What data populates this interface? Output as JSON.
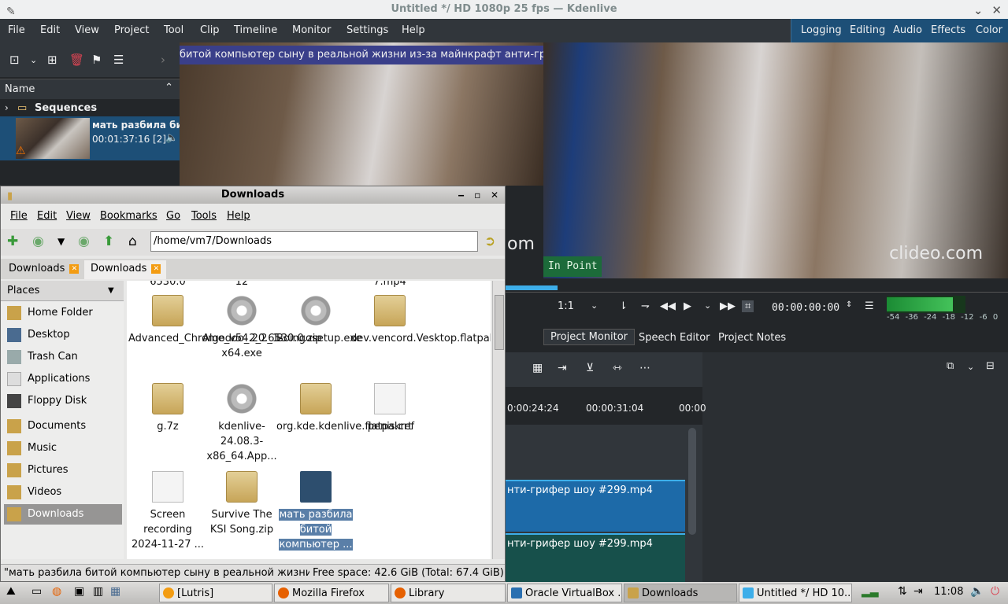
{
  "window": {
    "title": "Untitled */ HD 1080p 25 fps — Kdenlive"
  },
  "menubar": {
    "items": [
      "File",
      "Edit",
      "View",
      "Project",
      "Tool",
      "Clip",
      "Timeline",
      "Monitor",
      "Settings",
      "Help"
    ]
  },
  "layouts": [
    "Logging",
    "Editing",
    "Audio",
    "Effects",
    "Color"
  ],
  "bin": {
    "header": "Name",
    "sequences": "Sequences",
    "clip_name": "мать разбила бит",
    "clip_info": "00:01:37:16 [2]"
  },
  "project_monitor": {
    "caption": "битой компьютер сыну в реальной жизни из-за майнкрафт анти-грифер ш"
  },
  "clip_monitor": {
    "watermark": "clideo.com",
    "watermark_partial": "om",
    "in_point": "In Point"
  },
  "monitor_controls": {
    "zoom": "1:1",
    "timecode": "00:00:00:00",
    "scale": [
      "-54",
      "-36",
      "-24",
      "-18",
      "-12",
      "-6",
      "0"
    ]
  },
  "monitor_tabs": [
    "Project Monitor",
    "Speech Editor",
    "Project Notes"
  ],
  "timeline": {
    "ticks": [
      "0:00:24:24",
      "00:00:31:04",
      "00:00"
    ],
    "video_clip": "нти-грифер шоу #299.mp4",
    "audio_clip": "нти-грифер шоу #299.mp4"
  },
  "filemanager": {
    "title": "Downloads",
    "menu": [
      "File",
      "Edit",
      "View",
      "Bookmarks",
      "Go",
      "Tools",
      "Help"
    ],
    "path": "/home/vm7/Downloads",
    "tabs": [
      "Downloads",
      "Downloads"
    ],
    "places_label": "Places",
    "places": [
      "Home Folder",
      "Desktop",
      "Trash Can",
      "Applications",
      "Floppy Disk",
      "Documents",
      "Music",
      "Pictures",
      "Videos",
      "Downloads"
    ],
    "partial_top": [
      "6530.0",
      "12",
      "7.mp4"
    ],
    "items": [
      {
        "label": "Advanced_Chrome_v54.20.6530.0.zip",
        "icon": "folder"
      },
      {
        "label": "Algodoo_2_2_1-x64.exe",
        "icon": "gear"
      },
      {
        "label": "Boingosetup.exe",
        "icon": "gear"
      },
      {
        "label": "dev.vencord.Vesktop.flatpakref",
        "icon": "folder"
      },
      {
        "label": "g.7z",
        "icon": "folder"
      },
      {
        "label": "kdenlive-24.08.3-x86_64.App...",
        "icon": "gear"
      },
      {
        "label": "org.kde.kdenlive.flatpakref",
        "icon": "folder"
      },
      {
        "label": "penis.crt",
        "icon": "doc"
      },
      {
        "label": "Screen recording 2024-11-27 ...",
        "icon": "doc"
      },
      {
        "label": "Survive The KSI Song.zip",
        "icon": "folder"
      },
      {
        "label": "мать разбила битой компьютер ...",
        "icon": "video"
      }
    ],
    "status_left": "\"мать разбила битой компьютер сыну в реальной жизни и...",
    "status_right": "Free space: 42.6 GiB (Total: 67.4 GiB)"
  },
  "taskbar": {
    "items": [
      "[Lutris]",
      "Mozilla Firefox",
      "Library",
      "Oracle VirtualBox ...",
      "Downloads",
      "Untitled */ HD 10..."
    ],
    "clock": "11:08"
  }
}
